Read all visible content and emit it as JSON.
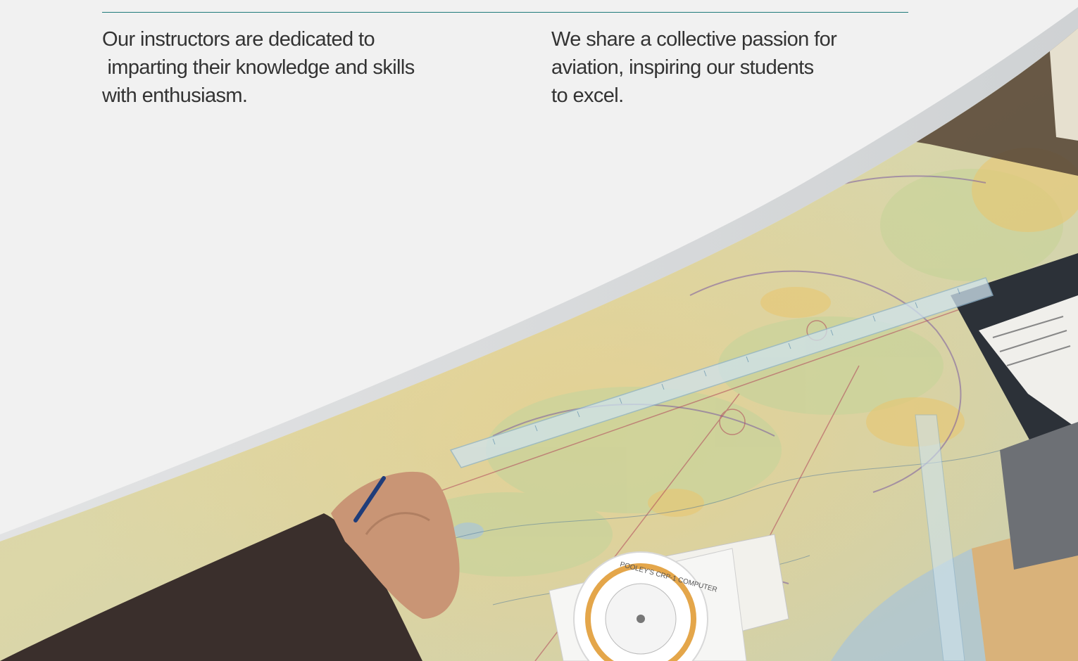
{
  "columns": {
    "left": {
      "lines": [
        "Our instructors are dedicated to",
        " imparting their knowledge and skills",
        "with enthusiasm."
      ]
    },
    "right": {
      "lines": [
        "We share a collective passion for",
        "aviation, inspiring our students",
        "to excel."
      ]
    }
  },
  "photo": {
    "subject": "flight planning on aeronautical chart with plotter and flight computer",
    "computer_label": "POOLEY'S CRP-1 COMPUTER"
  },
  "colors": {
    "background": "#f1f1f1",
    "divider": "#1f7a7a",
    "text": "#333333"
  }
}
